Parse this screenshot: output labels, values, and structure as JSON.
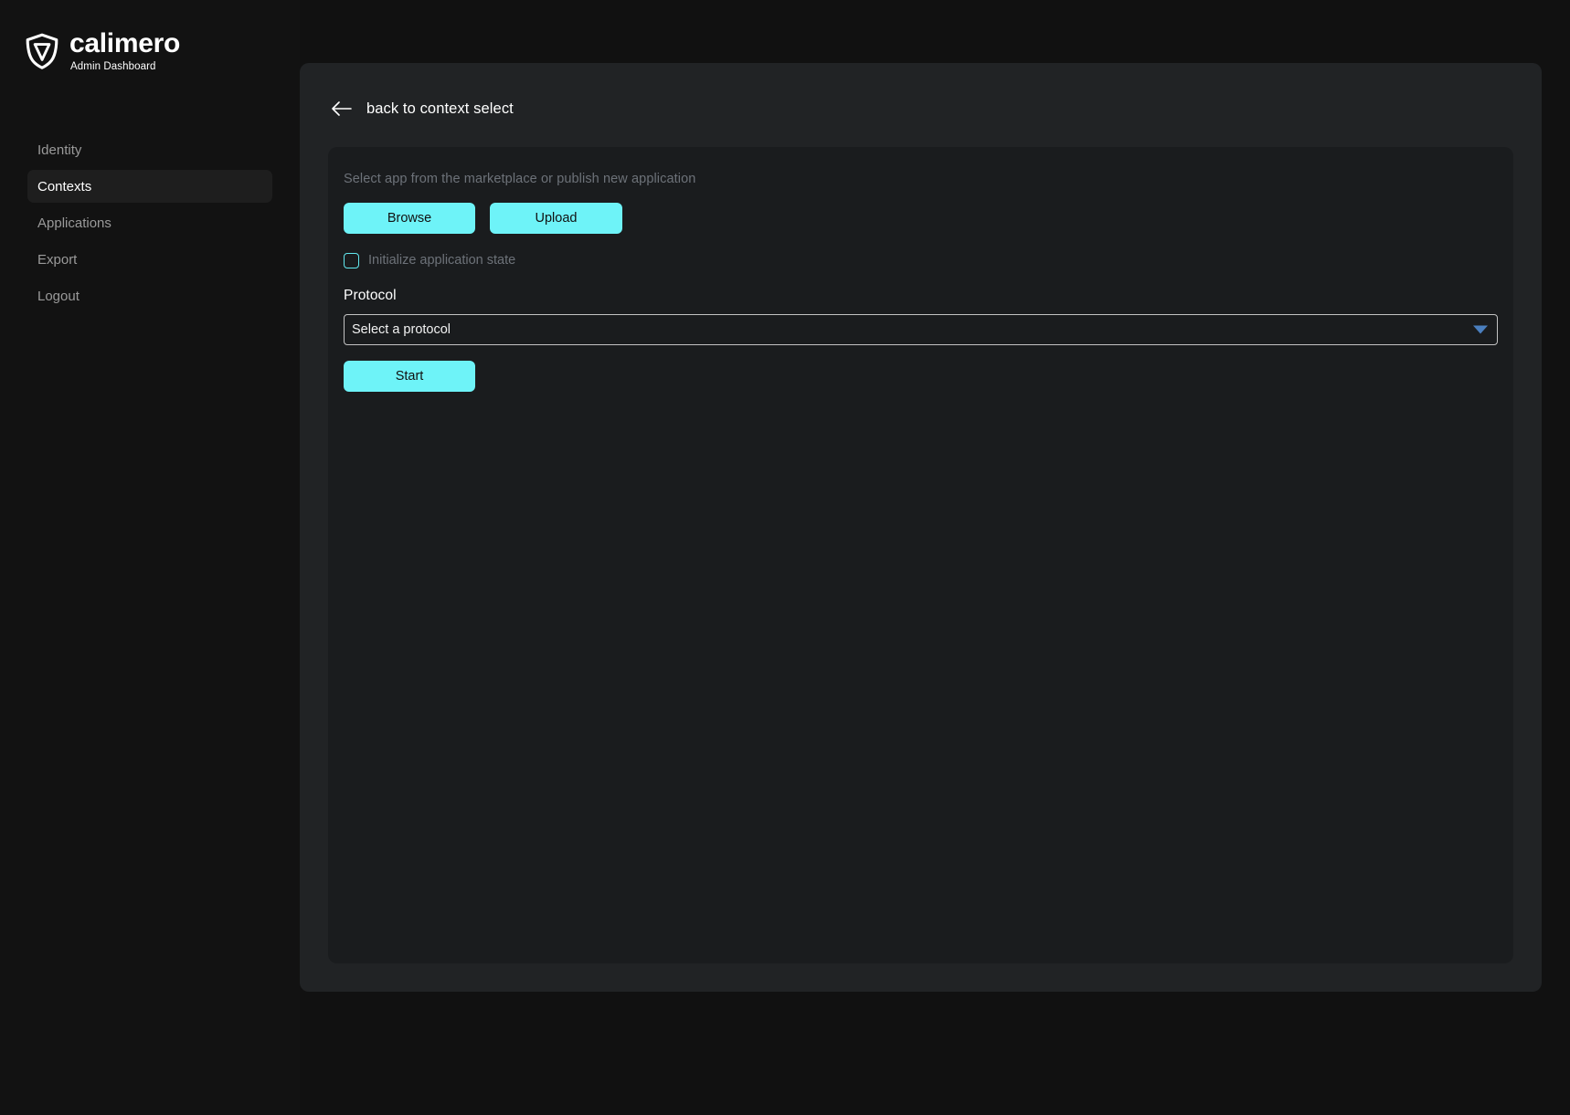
{
  "brand": {
    "name": "calimero",
    "subtitle": "Admin Dashboard",
    "logo_icon": "shield-logo-icon"
  },
  "sidebar": {
    "items": [
      {
        "label": "Identity",
        "active": false,
        "name": "sidebar-item-identity"
      },
      {
        "label": "Contexts",
        "active": true,
        "name": "sidebar-item-contexts"
      },
      {
        "label": "Applications",
        "active": false,
        "name": "sidebar-item-applications"
      },
      {
        "label": "Export",
        "active": false,
        "name": "sidebar-item-export"
      },
      {
        "label": "Logout",
        "active": false,
        "name": "sidebar-item-logout"
      }
    ]
  },
  "panel": {
    "back_label": "back to context select",
    "back_icon": "arrow-left-icon"
  },
  "card": {
    "description": "Select app from the marketplace or publish new application",
    "browse_label": "Browse",
    "upload_label": "Upload",
    "checkbox_label": "Initialize application state",
    "checkbox_checked": false,
    "protocol_label": "Protocol",
    "protocol_selected": "Select a protocol",
    "protocol_arrow_icon": "chevron-down-icon",
    "start_label": "Start"
  },
  "colors": {
    "accent_cyan": "#6ef3f8",
    "page_background": "#111111",
    "sidebar_background": "#121212",
    "panel_background": "#212325",
    "card_background": "#1a1c1e",
    "muted_text": "#6d7279",
    "active_nav_background": "#1e1e1e",
    "select_arrow_blue": "#4a7fbf"
  }
}
